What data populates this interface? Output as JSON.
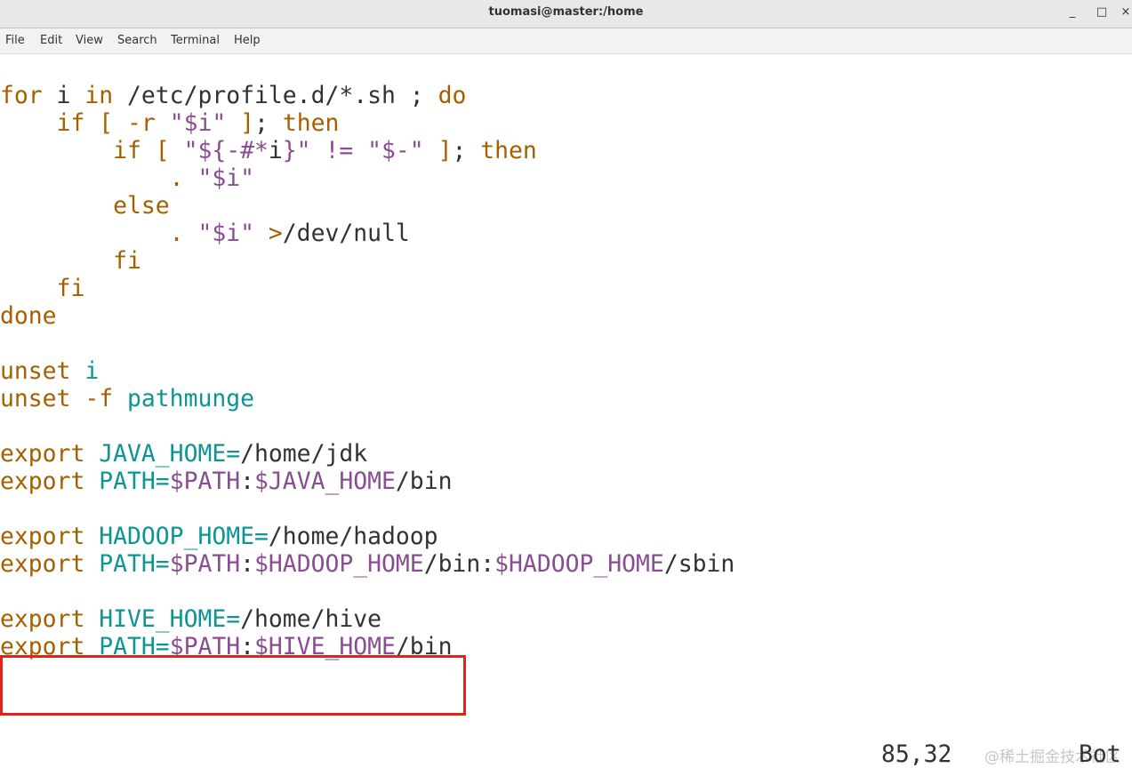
{
  "window": {
    "title": "tuomasi@master:/home",
    "minimize_glyph": "_",
    "maximize_glyph": "□",
    "close_glyph": "×"
  },
  "menu": [
    "File",
    "Edit",
    "View",
    "Search",
    "Terminal",
    "Help"
  ],
  "lines": [
    [
      [
        "kw",
        "for"
      ],
      [
        "p",
        " i "
      ],
      [
        "kw",
        "in"
      ],
      [
        "p",
        " /etc/profile.d/*.sh ; "
      ],
      [
        "kw",
        "do"
      ]
    ],
    [
      [
        "p",
        "    "
      ],
      [
        "kw",
        "if"
      ],
      [
        "p",
        " "
      ],
      [
        "kw",
        "["
      ],
      [
        "p",
        " "
      ],
      [
        "kw",
        "-r"
      ],
      [
        "p",
        " "
      ],
      [
        "str",
        "\"$i\""
      ],
      [
        "p",
        " "
      ],
      [
        "kw",
        "]"
      ],
      [
        "p",
        "; "
      ],
      [
        "kw",
        "then"
      ]
    ],
    [
      [
        "p",
        "        "
      ],
      [
        "kw",
        "if"
      ],
      [
        "p",
        " "
      ],
      [
        "kw",
        "["
      ],
      [
        "p",
        " "
      ],
      [
        "str",
        "\"${-#*"
      ],
      [
        "p",
        "i"
      ],
      [
        "str",
        "}\""
      ],
      [
        "p",
        " "
      ],
      [
        "str",
        "!="
      ],
      [
        "p",
        " "
      ],
      [
        "str",
        "\"$-\""
      ],
      [
        "p",
        " "
      ],
      [
        "kw",
        "]"
      ],
      [
        "p",
        "; "
      ],
      [
        "kw",
        "then"
      ]
    ],
    [
      [
        "p",
        "            "
      ],
      [
        "kw",
        "."
      ],
      [
        "p",
        " "
      ],
      [
        "str",
        "\"$i\""
      ]
    ],
    [
      [
        "p",
        "        "
      ],
      [
        "kw",
        "else"
      ]
    ],
    [
      [
        "p",
        "            "
      ],
      [
        "kw",
        "."
      ],
      [
        "p",
        " "
      ],
      [
        "str",
        "\"$i\""
      ],
      [
        "p",
        " "
      ],
      [
        "kw",
        ">"
      ],
      [
        "p",
        "/dev/null"
      ]
    ],
    [
      [
        "p",
        "        "
      ],
      [
        "kw",
        "fi"
      ]
    ],
    [
      [
        "p",
        "    "
      ],
      [
        "kw",
        "fi"
      ]
    ],
    [
      [
        "kw",
        "done"
      ]
    ],
    [],
    [
      [
        "kw",
        "unset"
      ],
      [
        "p",
        " "
      ],
      [
        "var",
        "i"
      ]
    ],
    [
      [
        "kw",
        "unset"
      ],
      [
        "p",
        " "
      ],
      [
        "kw",
        "-f"
      ],
      [
        "p",
        " "
      ],
      [
        "var",
        "pathmunge"
      ]
    ],
    [],
    [
      [
        "kw",
        "export"
      ],
      [
        "p",
        " "
      ],
      [
        "var",
        "JAVA_HOME="
      ],
      [
        "p",
        "/home/jdk"
      ]
    ],
    [
      [
        "kw",
        "export"
      ],
      [
        "p",
        " "
      ],
      [
        "var",
        "PATH="
      ],
      [
        "str",
        "$PATH"
      ],
      [
        "p",
        ":"
      ],
      [
        "str",
        "$JAVA_HOME"
      ],
      [
        "p",
        "/bin"
      ]
    ],
    [],
    [
      [
        "kw",
        "export"
      ],
      [
        "p",
        " "
      ],
      [
        "var",
        "HADOOP_HOME="
      ],
      [
        "p",
        "/home/hadoop"
      ]
    ],
    [
      [
        "kw",
        "export"
      ],
      [
        "p",
        " "
      ],
      [
        "var",
        "PATH="
      ],
      [
        "str",
        "$PATH"
      ],
      [
        "p",
        ":"
      ],
      [
        "str",
        "$HADOOP_HOME"
      ],
      [
        "p",
        "/bin:"
      ],
      [
        "str",
        "$HADOOP_HOME"
      ],
      [
        "p",
        "/sbin"
      ]
    ],
    [],
    [
      [
        "kw",
        "export"
      ],
      [
        "p",
        " "
      ],
      [
        "var",
        "HIVE_HOME="
      ],
      [
        "p",
        "/home/hive"
      ]
    ],
    [
      [
        "kw",
        "export"
      ],
      [
        "p",
        " "
      ],
      [
        "var",
        "PATH="
      ],
      [
        "str",
        "$PATH"
      ],
      [
        "p",
        ":"
      ],
      [
        "str",
        "$HIVE_HOME"
      ],
      [
        "p",
        "/bin"
      ]
    ]
  ],
  "status": {
    "position": "85,32",
    "scroll": "Bot"
  },
  "watermark": "@稀土掘金技术社区",
  "colors": {
    "keyword": "#a65f00",
    "variable": "#0d9494",
    "string": "#8a4c92",
    "plain": "#2e3436",
    "highlight_box": "#e2231a"
  }
}
